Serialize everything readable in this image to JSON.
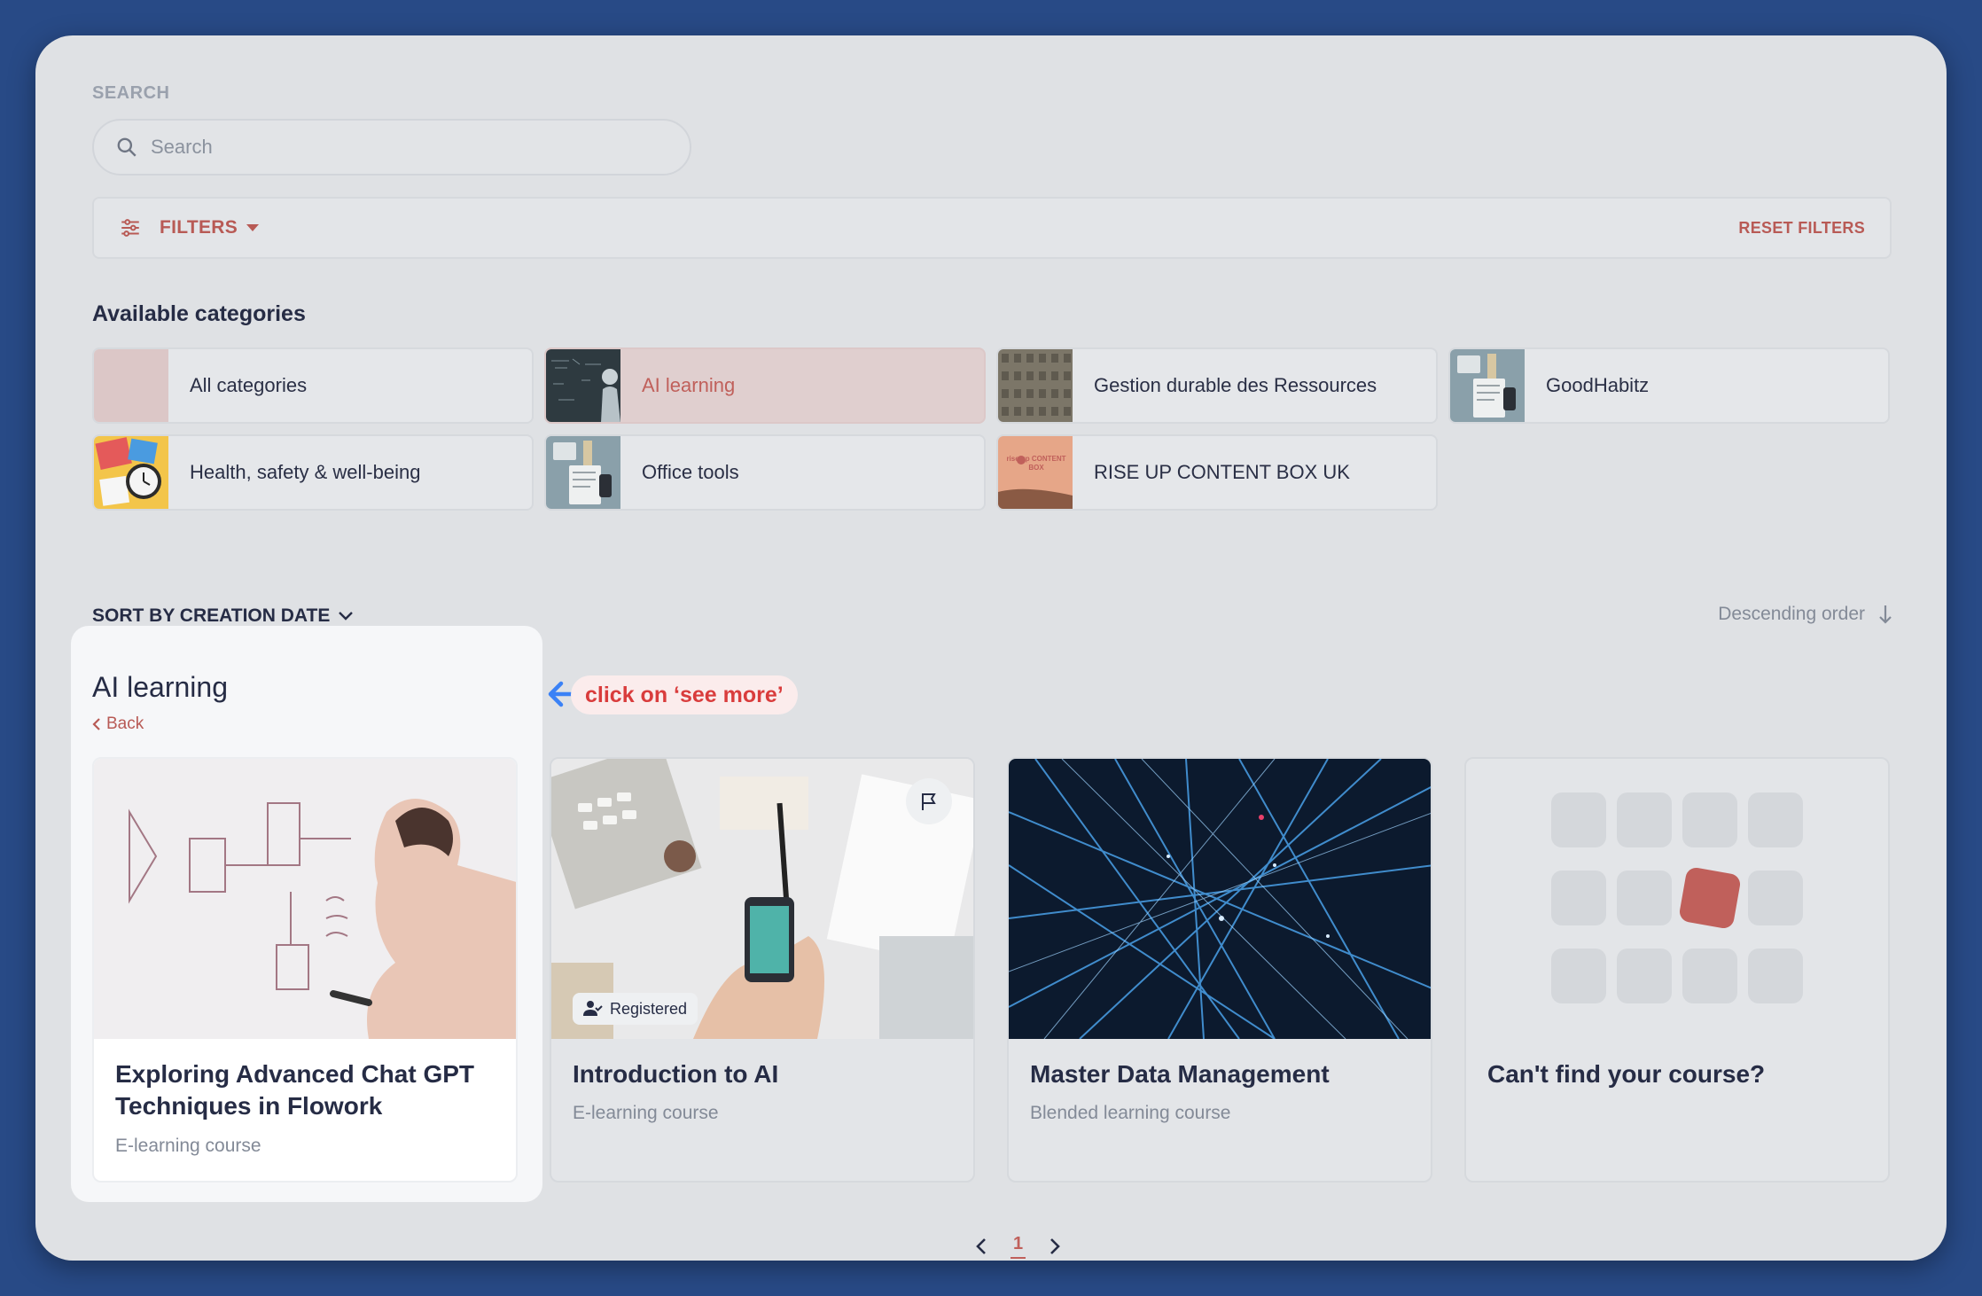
{
  "search": {
    "label": "SEARCH",
    "placeholder": "Search"
  },
  "filters": {
    "label": "FILTERS",
    "reset_label": "RESET FILTERS"
  },
  "categories": {
    "title": "Available categories",
    "items": [
      {
        "label": "All categories",
        "active": false
      },
      {
        "label": "AI learning",
        "active": true
      },
      {
        "label": "Gestion durable des Ressources",
        "active": false
      },
      {
        "label": "GoodHabitz",
        "active": false
      },
      {
        "label": "Health, safety & well-being",
        "active": false
      },
      {
        "label": "Office tools",
        "active": false
      },
      {
        "label": "RISE UP CONTENT BOX UK",
        "active": false,
        "thumb_text": "rise up CONTENT BOX"
      }
    ]
  },
  "sort": {
    "label": "SORT BY CREATION DATE",
    "order_label": "Descending order"
  },
  "section": {
    "title": "AI learning",
    "back_label": "Back",
    "callout": "click on ‘see more’"
  },
  "courses": [
    {
      "title": "Exploring Advanced Chat GPT Techniques in Flowork",
      "type": "E-learning course"
    },
    {
      "title": "Introduction to AI",
      "type": "E-learning course",
      "badge": "Registered"
    },
    {
      "title": "Master Data Management",
      "type": "Blended learning course"
    },
    {
      "title": "Can't find your course?"
    }
  ],
  "pagination": {
    "current": "1"
  },
  "colors": {
    "accent": "#b85a55",
    "background": "#284a86",
    "panel": "#dfe1e4",
    "callout_text": "#d93c3c",
    "arrow": "#3b82f6"
  }
}
